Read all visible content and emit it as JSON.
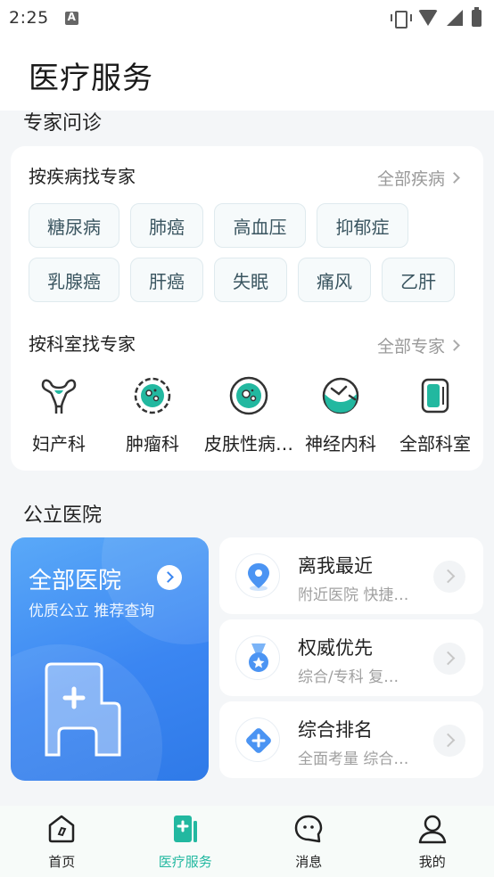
{
  "status_bar": {
    "time": "2:25"
  },
  "header": {
    "title": "医疗服务"
  },
  "expert_section": {
    "title": "专家问诊",
    "by_disease": {
      "title": "按疾病找专家",
      "more": "全部疾病",
      "diseases": [
        "糖尿病",
        "肺癌",
        "高血压",
        "抑郁症",
        "乳腺癌",
        "肝癌",
        "失眠",
        "痛风",
        "乙肝"
      ]
    },
    "by_department": {
      "title": "按科室找专家",
      "more": "全部专家",
      "departments": [
        {
          "label": "妇产科",
          "icon": "uterus-icon"
        },
        {
          "label": "肿瘤科",
          "icon": "tumor-cell-icon"
        },
        {
          "label": "皮肤性病…",
          "icon": "skin-icon"
        },
        {
          "label": "神经内科",
          "icon": "brain-icon"
        },
        {
          "label": "全部科室",
          "icon": "all-departments-icon"
        }
      ]
    }
  },
  "hospital_section": {
    "title": "公立医院",
    "all": {
      "title": "全部医院",
      "subtitle": "优质公立 推荐查询",
      "icon": "hospital-building-icon"
    },
    "cards": [
      {
        "title": "离我最近",
        "subtitle": "附近医院 快捷…",
        "icon": "location-pin-icon"
      },
      {
        "title": "权威优先",
        "subtitle": "综合/专科 复旦…",
        "icon": "medal-icon"
      },
      {
        "title": "综合排名",
        "subtitle": "全面考量 综合…",
        "icon": "diamond-plus-icon"
      }
    ]
  },
  "bottom_nav": [
    {
      "label": "首页",
      "icon": "home-icon",
      "active": false
    },
    {
      "label": "医疗服务",
      "icon": "medical-service-icon",
      "active": true
    },
    {
      "label": "消息",
      "icon": "message-icon",
      "active": false
    },
    {
      "label": "我的",
      "icon": "profile-icon",
      "active": false
    }
  ],
  "colors": {
    "accent": "#22b8a0",
    "hospital_blue": "#3b86f2"
  }
}
